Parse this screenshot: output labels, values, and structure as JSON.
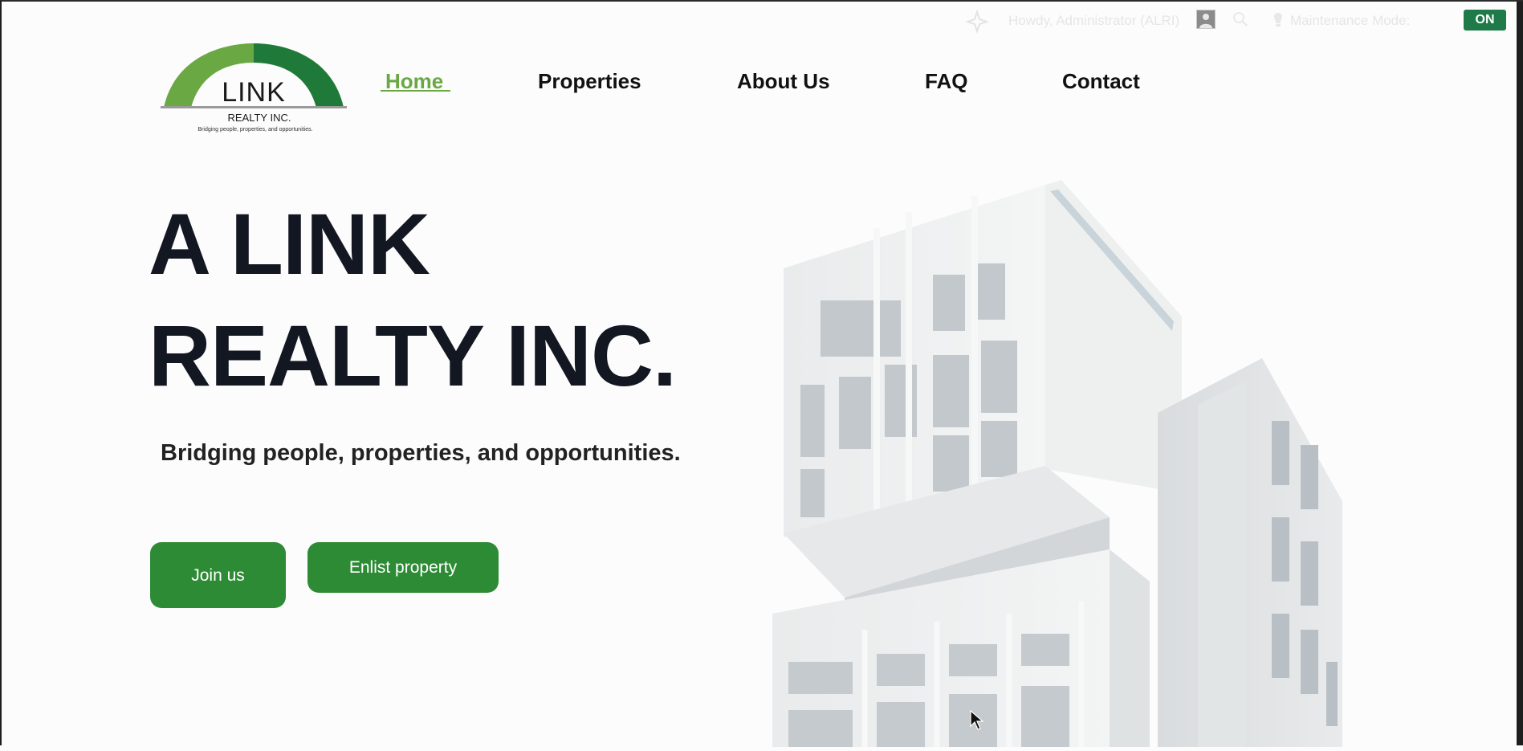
{
  "admin_bar": {
    "ai_icon": "sparkle-icon",
    "greeting": "Howdy, Administrator (ALRI)",
    "search_icon": "search-icon",
    "maintenance_icon": "lightbulb-icon",
    "maintenance_label": "Maintenance Mode:",
    "maintenance_status": "ON",
    "status_color": "#1f7a4a"
  },
  "logo": {
    "name": "LINK",
    "sub": "REALTY INC.",
    "tagline": "Bridging people, properties, and opportunities.",
    "colors": [
      "#6aa843",
      "#1f7a3a"
    ]
  },
  "nav": {
    "items": [
      {
        "label": "Home",
        "active": true
      },
      {
        "label": "Properties",
        "active": false
      },
      {
        "label": "About Us",
        "active": false
      },
      {
        "label": "FAQ",
        "active": false
      },
      {
        "label": "Contact",
        "active": false
      }
    ],
    "active_color": "#6aa843"
  },
  "hero": {
    "title_line1": "A LINK",
    "title_line2": "REALTY INC.",
    "tagline": "Bridging people, properties, and opportunities.",
    "join_button": "Join us",
    "enlist_button": "Enlist property",
    "button_color": "#2e8b35"
  }
}
